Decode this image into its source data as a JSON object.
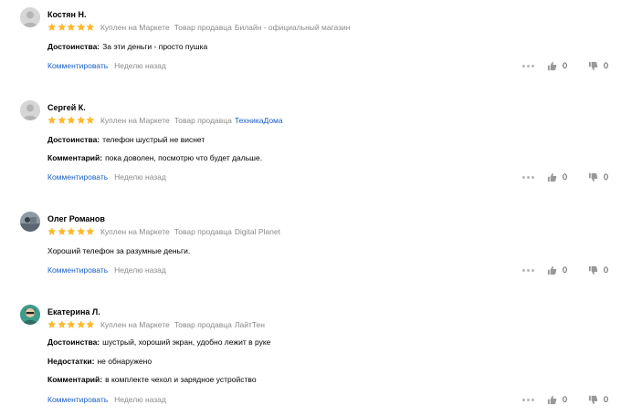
{
  "reviews": [
    {
      "author": "Костян Н.",
      "rating": 5,
      "bought_label": "Куплен на Маркете",
      "seller_prefix": "Товар продавца",
      "seller_name": "Билайн - официальный магазин",
      "seller_is_link": false,
      "fields": [
        {
          "label": "Достоинства:",
          "value": "За эти деньги - просто пушка"
        }
      ],
      "comment_link": "Комментировать",
      "date": "Неделю назад",
      "likes": "0",
      "dislikes": "0"
    },
    {
      "author": "Сергей К.",
      "rating": 5,
      "bought_label": "Куплен на Маркете",
      "seller_prefix": "Товар продавца",
      "seller_name": "ТехникаДома",
      "seller_is_link": true,
      "fields": [
        {
          "label": "Достоинства:",
          "value": "телефон шустрый не виснет"
        },
        {
          "label": "Комментарий:",
          "value": "пока доволен, посмотрю что будет дальше."
        }
      ],
      "comment_link": "Комментировать",
      "date": "Неделю назад",
      "likes": "0",
      "dislikes": "0"
    },
    {
      "author": "Олег Романов",
      "rating": 5,
      "bought_label": "Куплен на Маркете",
      "seller_prefix": "Товар продавца",
      "seller_name": "Digital Planet",
      "seller_is_link": false,
      "text": "Хороший телефон за разумные деньги.",
      "comment_link": "Комментировать",
      "date": "Неделю назад",
      "likes": "0",
      "dislikes": "0"
    },
    {
      "author": "Екатерина Л.",
      "rating": 5,
      "bought_label": "Куплен на Маркете",
      "seller_prefix": "Товар продавца",
      "seller_name": "ЛайтТен",
      "seller_is_link": false,
      "fields": [
        {
          "label": "Достоинства:",
          "value": "шустрый, хороший экран, удобно лежит в руке"
        },
        {
          "label": "Недостатки:",
          "value": "не обнаружено"
        },
        {
          "label": "Комментарий:",
          "value": "в комплекте чехол и зарядное устройство"
        }
      ],
      "comment_link": "Комментировать",
      "date": "Неделю назад",
      "likes": "0",
      "dislikes": "0"
    }
  ],
  "colors": {
    "star": "#fdb92d",
    "link": "#1a5fc7",
    "muted": "#8a8a8a"
  },
  "icons": {
    "avatar_default": "user-silhouette-icon",
    "star": "star-icon",
    "more": "more-dots-icon",
    "like": "thumb-up-icon",
    "dislike": "thumb-down-icon"
  }
}
